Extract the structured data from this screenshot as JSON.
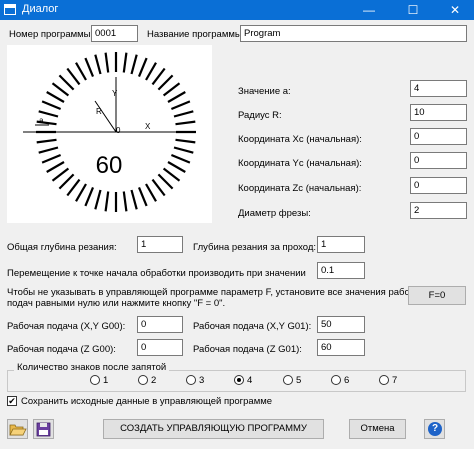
{
  "window": {
    "title": "Диалог",
    "minimize": "—",
    "maximize": "☐",
    "close": "✕",
    "titlebar_color": "#0a6fd6"
  },
  "program": {
    "number_label": "Номер программы:",
    "number_value": "0001",
    "name_label": "Название программы:",
    "name_value": "Program"
  },
  "diagram": {
    "y": "Y",
    "x": "X",
    "r": "R",
    "zero": "0",
    "a": "a",
    "big_number": "60"
  },
  "params": {
    "a_label": "Значение а:",
    "a_value": "4",
    "r_label": "Радиус R:",
    "r_value": "10",
    "xc_label": "Координата Xc (начальная):",
    "xc_value": "0",
    "yc_label": "Координата Yc (начальная):",
    "yc_value": "0",
    "zc_label": "Координата Zc (начальная):",
    "zc_value": "0",
    "d_label": "Диаметр фрезы:",
    "d_value": "2"
  },
  "cutting": {
    "total_label": "Общая глубина резания:",
    "total_value": "1",
    "pass_label": "Глубина резания за проход:",
    "pass_value": "1",
    "move_label": "Перемещение к точке начала обработки производить при значении",
    "move_value": "0.1",
    "note_line1": "Чтобы не указывать в управляющей программе параметр F, установите все значения рабочих",
    "note_line2": "подач равными нулю или нажмите кнопку \"F = 0\".",
    "f0_button": "F=0"
  },
  "feeds": {
    "xy_g00_label": "Рабочая подача (X,Y G00):",
    "xy_g00_value": "0",
    "xy_g01_label": "Рабочая подача (X,Y G01):",
    "xy_g01_value": "50",
    "z_g00_label": "Рабочая подача (Z G00):",
    "z_g00_value": "0",
    "z_g01_label": "Рабочая подача (Z G01):",
    "z_g01_value": "60"
  },
  "decimals": {
    "title": "Количество знаков после запятой",
    "options": [
      "1",
      "2",
      "3",
      "4",
      "5",
      "6",
      "7"
    ],
    "selected": "4"
  },
  "save_checkbox": {
    "checked": true,
    "mark": "✔",
    "label": "Сохранить исходные данные в управляющей программе"
  },
  "footer": {
    "create_button": "СОЗДАТЬ УПРАВЛЯЮЩУЮ ПРОГРАММУ",
    "cancel_button": "Отмена",
    "help_button": "?"
  }
}
